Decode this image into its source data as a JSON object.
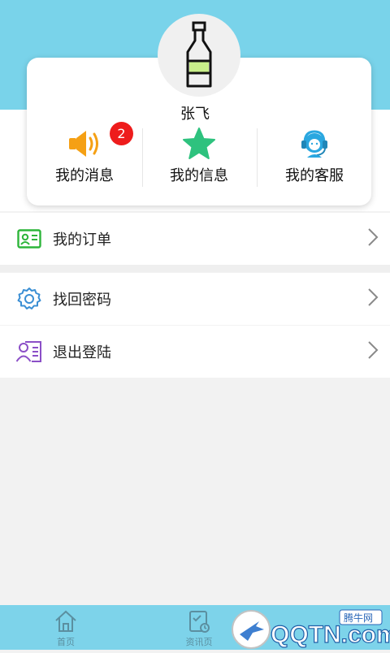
{
  "profile": {
    "username": "张飞"
  },
  "quick_actions": {
    "messages_label": "我的消息",
    "messages_badge": "2",
    "info_label": "我的信息",
    "service_label": "我的客服"
  },
  "menu": {
    "orders_label": "我的订单",
    "recover_password_label": "找回密码",
    "logout_label": "退出登陆"
  },
  "tabbar": {
    "home_label": "首页",
    "news_label": "资讯页"
  },
  "watermark": {
    "text": "QQTN.com",
    "badge": "腾牛网"
  },
  "colors": {
    "header": "#79d3ea",
    "badge": "#ee1c1c",
    "star": "#2ec27e",
    "speaker": "#f5a014",
    "headset": "#2aa7e0",
    "orders_icon": "#2db53a",
    "settings_icon": "#3b8fd4",
    "logout_icon": "#8b4fc7"
  }
}
